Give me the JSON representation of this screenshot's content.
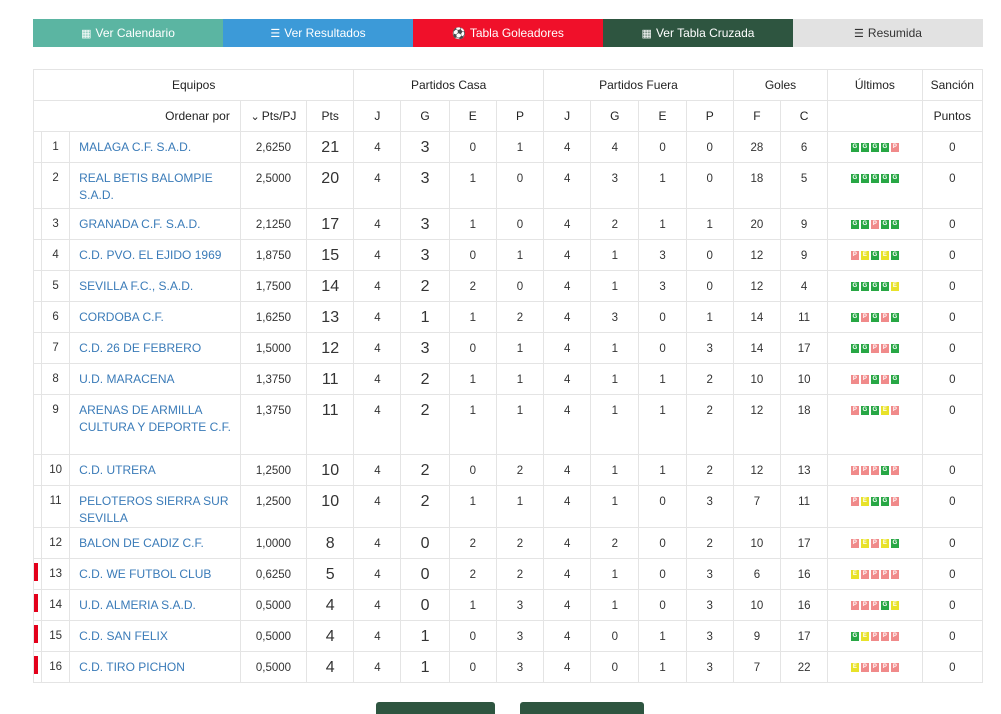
{
  "tabs": [
    {
      "label": "Ver Calendario",
      "icon": "calendar-icon",
      "glyph": "▦"
    },
    {
      "label": "Ver Resultados",
      "icon": "list-icon",
      "glyph": "☰"
    },
    {
      "label": "Tabla Goleadores",
      "icon": "soccer-ball-icon",
      "glyph": "⚽"
    },
    {
      "label": "Ver Tabla Cruzada",
      "icon": "grid-icon",
      "glyph": "▦"
    },
    {
      "label": "Resumida",
      "icon": "list-alt-icon",
      "glyph": "☰"
    }
  ],
  "headers": {
    "equipos": "Equipos",
    "casa": "Partidos Casa",
    "fuera": "Partidos Fuera",
    "goles": "Goles",
    "ultimos": "Últimos",
    "sancion": "Sanción",
    "ordenar": "Ordenar por",
    "ptspj": "Pts/PJ",
    "pts": "Pts",
    "j": "J",
    "g": "G",
    "e": "E",
    "p": "P",
    "f": "F",
    "c": "C",
    "puntos": "Puntos"
  },
  "colors": {
    "win": "#28a745",
    "draw": "#e8e22a",
    "loss": "#f08a8a",
    "relegation": "#e3001b"
  },
  "rows": [
    {
      "pos": "1",
      "team": "MALAGA C.F. S.A.D.",
      "ptspj": "2,6250",
      "pts": "21",
      "hj": "4",
      "hg": "3",
      "he": "0",
      "hp": "1",
      "aj": "4",
      "ag": "4",
      "ae": "0",
      "ap": "0",
      "f": "28",
      "c": "6",
      "last": "GGGGP",
      "sancion": "0",
      "mark": false
    },
    {
      "pos": "2",
      "team": "REAL BETIS BALOMPIE S.A.D.",
      "ptspj": "2,5000",
      "pts": "20",
      "hj": "4",
      "hg": "3",
      "he": "1",
      "hp": "0",
      "aj": "4",
      "ag": "3",
      "ae": "1",
      "ap": "0",
      "f": "18",
      "c": "5",
      "last": "GGGGG",
      "sancion": "0",
      "mark": false
    },
    {
      "pos": "3",
      "team": "GRANADA C.F. S.A.D.",
      "ptspj": "2,1250",
      "pts": "17",
      "hj": "4",
      "hg": "3",
      "he": "1",
      "hp": "0",
      "aj": "4",
      "ag": "2",
      "ae": "1",
      "ap": "1",
      "f": "20",
      "c": "9",
      "last": "GGPGG",
      "sancion": "0",
      "mark": false
    },
    {
      "pos": "4",
      "team": "C.D. PVO. EL EJIDO 1969",
      "ptspj": "1,8750",
      "pts": "15",
      "hj": "4",
      "hg": "3",
      "he": "0",
      "hp": "1",
      "aj": "4",
      "ag": "1",
      "ae": "3",
      "ap": "0",
      "f": "12",
      "c": "9",
      "last": "PEGEG",
      "sancion": "0",
      "mark": false
    },
    {
      "pos": "5",
      "team": "SEVILLA F.C., S.A.D.",
      "ptspj": "1,7500",
      "pts": "14",
      "hj": "4",
      "hg": "2",
      "he": "2",
      "hp": "0",
      "aj": "4",
      "ag": "1",
      "ae": "3",
      "ap": "0",
      "f": "12",
      "c": "4",
      "last": "GGGGE",
      "sancion": "0",
      "mark": false
    },
    {
      "pos": "6",
      "team": "CORDOBA C.F.",
      "ptspj": "1,6250",
      "pts": "13",
      "hj": "4",
      "hg": "1",
      "he": "1",
      "hp": "2",
      "aj": "4",
      "ag": "3",
      "ae": "0",
      "ap": "1",
      "f": "14",
      "c": "11",
      "last": "GPGPG",
      "sancion": "0",
      "mark": false
    },
    {
      "pos": "7",
      "team": "C.D. 26 DE FEBRERO",
      "ptspj": "1,5000",
      "pts": "12",
      "hj": "4",
      "hg": "3",
      "he": "0",
      "hp": "1",
      "aj": "4",
      "ag": "1",
      "ae": "0",
      "ap": "3",
      "f": "14",
      "c": "17",
      "last": "GGPPG",
      "sancion": "0",
      "mark": false
    },
    {
      "pos": "8",
      "team": "U.D. MARACENA",
      "ptspj": "1,3750",
      "pts": "11",
      "hj": "4",
      "hg": "2",
      "he": "1",
      "hp": "1",
      "aj": "4",
      "ag": "1",
      "ae": "1",
      "ap": "2",
      "f": "10",
      "c": "10",
      "last": "PPGPG",
      "sancion": "0",
      "mark": false
    },
    {
      "pos": "9",
      "team": "ARENAS DE ARMILLA CULTURA Y DEPORTE C.F.",
      "ptspj": "1,3750",
      "pts": "11",
      "hj": "4",
      "hg": "2",
      "he": "1",
      "hp": "1",
      "aj": "4",
      "ag": "1",
      "ae": "1",
      "ap": "2",
      "f": "12",
      "c": "18",
      "last": "PGGEP",
      "sancion": "0",
      "mark": false
    },
    {
      "pos": "10",
      "team": "C.D. UTRERA",
      "ptspj": "1,2500",
      "pts": "10",
      "hj": "4",
      "hg": "2",
      "he": "0",
      "hp": "2",
      "aj": "4",
      "ag": "1",
      "ae": "1",
      "ap": "2",
      "f": "12",
      "c": "13",
      "last": "PPPGP",
      "sancion": "0",
      "mark": false
    },
    {
      "pos": "11",
      "team": "PELOTEROS SIERRA SUR SEVILLA",
      "ptspj": "1,2500",
      "pts": "10",
      "hj": "4",
      "hg": "2",
      "he": "1",
      "hp": "1",
      "aj": "4",
      "ag": "1",
      "ae": "0",
      "ap": "3",
      "f": "7",
      "c": "11",
      "last": "PEGGP",
      "sancion": "0",
      "mark": false
    },
    {
      "pos": "12",
      "team": "BALON DE CADIZ C.F.",
      "ptspj": "1,0000",
      "pts": "8",
      "hj": "4",
      "hg": "0",
      "he": "2",
      "hp": "2",
      "aj": "4",
      "ag": "2",
      "ae": "0",
      "ap": "2",
      "f": "10",
      "c": "17",
      "last": "PEPEG",
      "sancion": "0",
      "mark": false
    },
    {
      "pos": "13",
      "team": "C.D. WE FUTBOL CLUB",
      "ptspj": "0,6250",
      "pts": "5",
      "hj": "4",
      "hg": "0",
      "he": "2",
      "hp": "2",
      "aj": "4",
      "ag": "1",
      "ae": "0",
      "ap": "3",
      "f": "6",
      "c": "16",
      "last": "EPPPP",
      "sancion": "0",
      "mark": true
    },
    {
      "pos": "14",
      "team": "U.D. ALMERIA S.A.D.",
      "ptspj": "0,5000",
      "pts": "4",
      "hj": "4",
      "hg": "0",
      "he": "1",
      "hp": "3",
      "aj": "4",
      "ag": "1",
      "ae": "0",
      "ap": "3",
      "f": "10",
      "c": "16",
      "last": "PPPGE",
      "sancion": "0",
      "mark": true
    },
    {
      "pos": "15",
      "team": "C.D. SAN FELIX",
      "ptspj": "0,5000",
      "pts": "4",
      "hj": "4",
      "hg": "1",
      "he": "0",
      "hp": "3",
      "aj": "4",
      "ag": "0",
      "ae": "1",
      "ap": "3",
      "f": "9",
      "c": "17",
      "last": "GEPPP",
      "sancion": "0",
      "mark": true
    },
    {
      "pos": "16",
      "team": "C.D. TIRO PICHON",
      "ptspj": "0,5000",
      "pts": "4",
      "hj": "4",
      "hg": "1",
      "he": "0",
      "hp": "3",
      "aj": "4",
      "ag": "0",
      "ae": "1",
      "ap": "3",
      "f": "7",
      "c": "22",
      "last": "EPPPP",
      "sancion": "0",
      "mark": true
    }
  ]
}
